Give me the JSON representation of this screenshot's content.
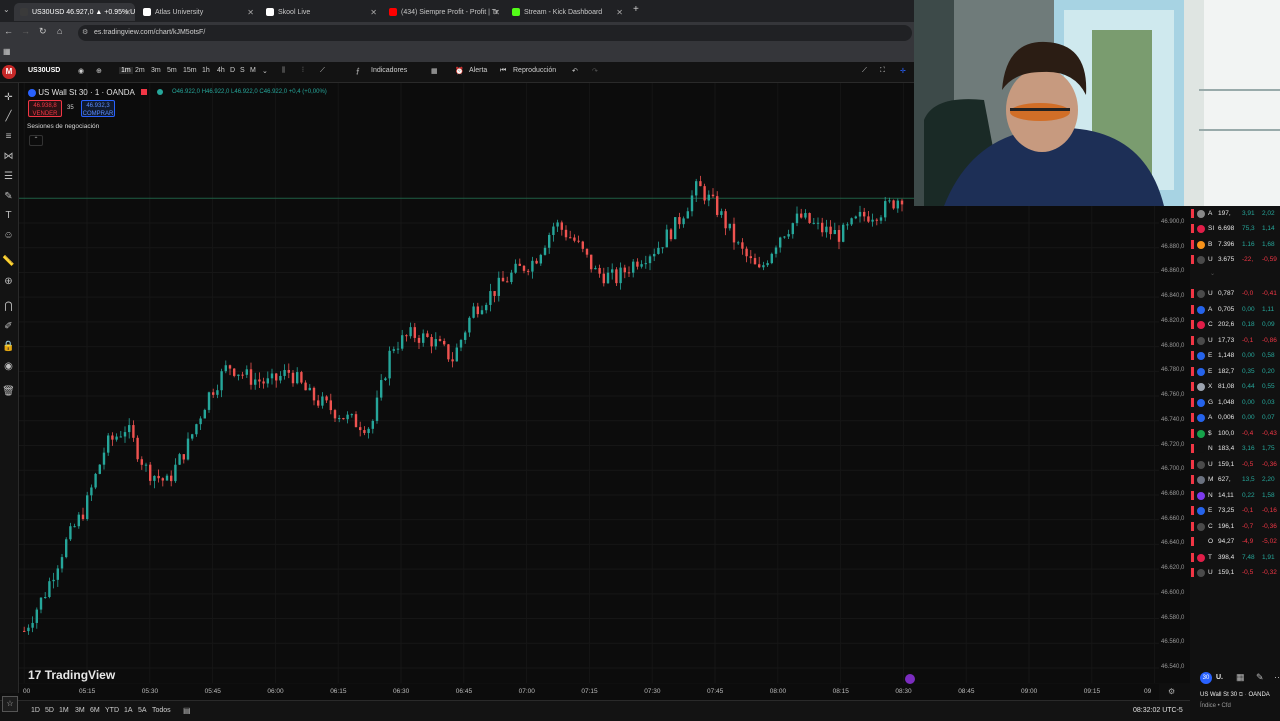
{
  "browser": {
    "tabs": [
      {
        "label": "US30USD 46.927,0 ▲ +0.95% U",
        "color": "#3a3a3a",
        "active": true
      },
      {
        "label": "Atlas University",
        "color": "#ffffff",
        "active": false
      },
      {
        "label": "Skool Live",
        "color": "#ffffff",
        "active": false
      },
      {
        "label": "(434) Siempre Profit - Profit | Tr",
        "color": "#ff0000",
        "active": false
      },
      {
        "label": "Stream - Kick Dashboard",
        "color": "#53fc18",
        "active": false
      }
    ],
    "url": "es.tradingview.com/chart/kJM5otsF/"
  },
  "toolbar": {
    "symbol": "US30USD",
    "intervals": [
      "1m",
      "2m",
      "3m",
      "5m",
      "15m",
      "1h",
      "4h",
      "D",
      "S",
      "M"
    ],
    "indicators": "Indicadores",
    "alert": "Alerta",
    "replay": "Reproducción"
  },
  "legend": {
    "title": "US Wall St 30 · 1 · OANDA",
    "ohlc": "O46.922,0 H46.922,0 L46.922,0 C46.922,0 +0,4 (+0,00%)",
    "sell_price": "46.938,8",
    "sell_label": "VENDER",
    "spread": "35",
    "buy_price": "46.932,3",
    "buy_label": "COMPRAR",
    "sessions": "Sesiones de negociación"
  },
  "logo": "TradingView",
  "bottom": {
    "ranges": [
      "1D",
      "5D",
      "1M",
      "3M",
      "6M",
      "YTD",
      "1A",
      "5A",
      "Todos"
    ],
    "clock": "08:32:02 UTC-5"
  },
  "chart_data": {
    "type": "candlestick",
    "title": "US Wall St 30 · 1 · OANDA",
    "ylim": [
      46530,
      46960
    ],
    "yticks": [
      "46.900,0",
      "46.880,0",
      "46.860,0",
      "46.840,0",
      "46.820,0",
      "46.800,0",
      "46.780,0",
      "46.760,0",
      "46.740,0",
      "46.720,0",
      "46.700,0",
      "46.680,0",
      "46.660,0",
      "46.640,0",
      "46.620,0",
      "46.600,0",
      "46.580,0",
      "46.560,0",
      "46.540,0"
    ],
    "ytick_values": [
      46900,
      46880,
      46860,
      46840,
      46820,
      46800,
      46780,
      46760,
      46740,
      46720,
      46700,
      46680,
      46660,
      46640,
      46620,
      46600,
      46580,
      46560,
      46540
    ],
    "xticks": [
      "00",
      "05:15",
      "05:30",
      "05:45",
      "06:00",
      "06:15",
      "06:30",
      "06:45",
      "07:00",
      "07:15",
      "07:30",
      "07:45",
      "08:00",
      "08:15",
      "08:30",
      "08:45",
      "09:00",
      "09:15",
      "09"
    ],
    "horizontal_line": 46920,
    "price_path": [
      46570,
      46600,
      46640,
      46670,
      46720,
      46735,
      46700,
      46690,
      46720,
      46760,
      46785,
      46775,
      46770,
      46780,
      46760,
      46750,
      46740,
      46735,
      46800,
      46810,
      46805,
      46790,
      46830,
      46845,
      46860,
      46870,
      46900,
      46885,
      46860,
      46855,
      46870,
      46880,
      46900,
      46930,
      46910,
      46880,
      46860,
      46890,
      46905,
      46895,
      46890,
      46905,
      46910,
      46922
    ],
    "up_color": "#26a69a",
    "down_color": "#ef5350"
  },
  "watchlist": [
    {
      "sym": "A",
      "last": "197,",
      "chg": "3,91",
      "pct": "2,02",
      "color": "#888888",
      "up": true
    },
    {
      "sym": "SI",
      "last": "6.698",
      "chg": "75,3",
      "pct": "1,14",
      "color": "#e11d48",
      "up": true
    },
    {
      "sym": "B",
      "last": "7.396",
      "chg": "1.16",
      "pct": "1,68",
      "color": "#f7931a",
      "up": true
    },
    {
      "sym": "U",
      "last": "3.675",
      "chg": "-22,",
      "pct": "-0,59",
      "color": "#4a4a4a",
      "up": false
    },
    {
      "sym": "U",
      "last": "0,787",
      "chg": "-0,0",
      "pct": "-0,41",
      "color": "#4a4a4a",
      "up": false
    },
    {
      "sym": "A",
      "last": "0,705",
      "chg": "0,00",
      "pct": "1,11",
      "color": "#2563eb",
      "up": true
    },
    {
      "sym": "C",
      "last": "202,6",
      "chg": "0,18",
      "pct": "0,09",
      "color": "#e11d48",
      "up": true
    },
    {
      "sym": "U",
      "last": "17,73",
      "chg": "-0,1",
      "pct": "-0,86",
      "color": "#4a4a4a",
      "up": false
    },
    {
      "sym": "E",
      "last": "1,148",
      "chg": "0,00",
      "pct": "0,58",
      "color": "#2563eb",
      "up": true
    },
    {
      "sym": "E",
      "last": "182,7",
      "chg": "0,35",
      "pct": "0,20",
      "color": "#2563eb",
      "up": true
    },
    {
      "sym": "X",
      "last": "81,08",
      "chg": "0,44",
      "pct": "0,55",
      "color": "#9ca3af",
      "up": true
    },
    {
      "sym": "G",
      "last": "1,048",
      "chg": "0,00",
      "pct": "0,03",
      "color": "#2563eb",
      "up": true
    },
    {
      "sym": "A",
      "last": "0,006",
      "chg": "0,00",
      "pct": "0,07",
      "color": "#2563eb",
      "up": true
    },
    {
      "sym": "$",
      "last": "100,0",
      "chg": "-0,4",
      "pct": "-0,43",
      "color": "#16a34a",
      "up": false
    },
    {
      "sym": "N",
      "last": "183,4",
      "chg": "3,16",
      "pct": "1,75",
      "color": "#111111",
      "up": true
    },
    {
      "sym": "U",
      "last": "159,1",
      "chg": "-0,5",
      "pct": "-0,36",
      "color": "#4a4a4a",
      "up": false
    },
    {
      "sym": "M",
      "last": "627,",
      "chg": "13,5",
      "pct": "2,20",
      "color": "#6b7280",
      "up": true
    },
    {
      "sym": "N",
      "last": "14,11",
      "chg": "0,22",
      "pct": "1,58",
      "color": "#7c3aed",
      "up": true
    },
    {
      "sym": "E",
      "last": "73,25",
      "chg": "-0,1",
      "pct": "-0,16",
      "color": "#2563eb",
      "up": false
    },
    {
      "sym": "C",
      "last": "196,1",
      "chg": "-0,7",
      "pct": "-0,36",
      "color": "#4a4a4a",
      "up": false
    },
    {
      "sym": "O",
      "last": "94,27",
      "chg": "-4,9",
      "pct": "-5,02",
      "color": "#111111",
      "up": false
    },
    {
      "sym": "T",
      "last": "398,4",
      "chg": "7,48",
      "pct": "1,91",
      "color": "#e11d48",
      "up": true
    },
    {
      "sym": "U",
      "last": "159,1",
      "chg": "-0,5",
      "pct": "-0,32",
      "color": "#4a4a4a",
      "up": false
    }
  ],
  "mini": {
    "sym": "U.",
    "name": "US Wall St 30",
    "exchange": "OANDA",
    "sub": "Índice • Cfd"
  }
}
